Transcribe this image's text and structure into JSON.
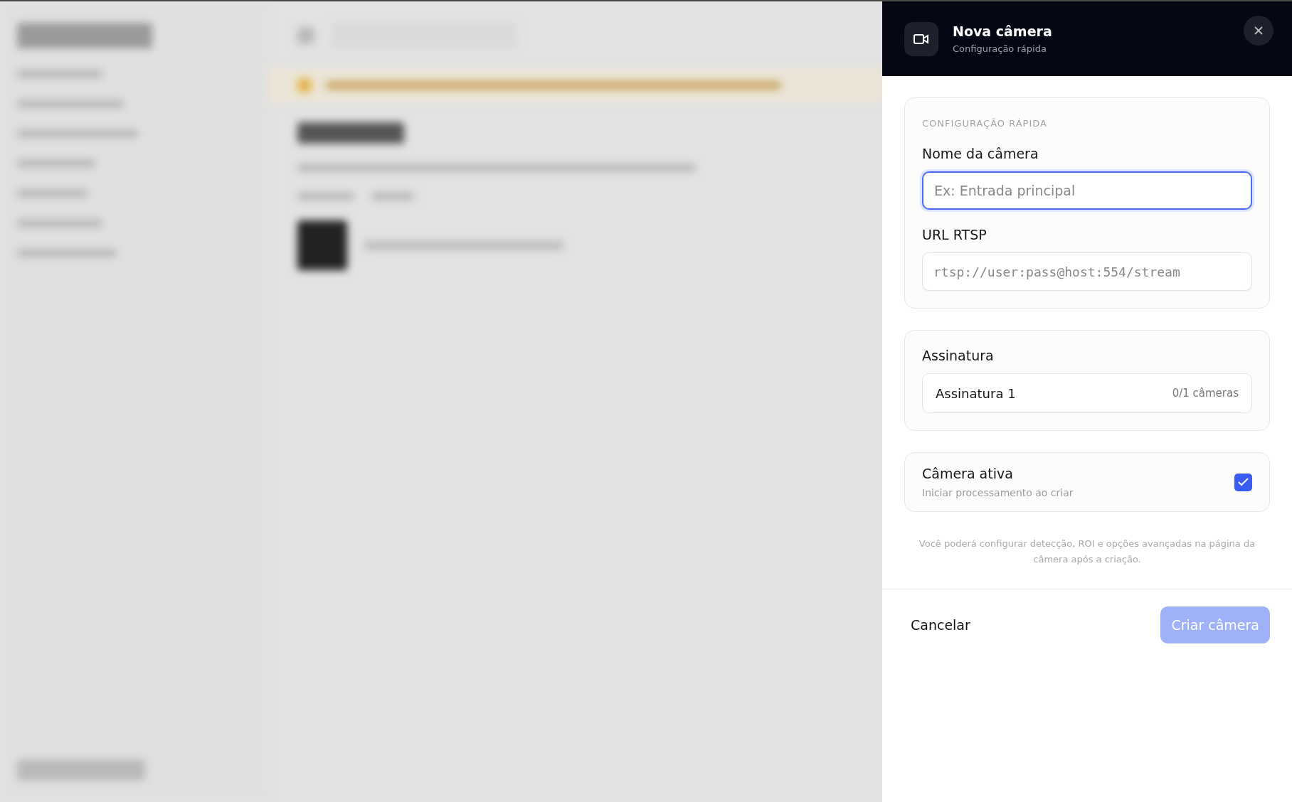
{
  "drawer": {
    "title": "Nova câmera",
    "subtitle": "Configuração rápida"
  },
  "quick_config": {
    "section_label": "CONFIGURAÇÃO RÁPIDA",
    "fields": [
      {
        "label": "Nome da câmera",
        "placeholder": "Ex: Entrada principal",
        "kind": "text",
        "focused": true
      },
      {
        "label": "URL RTSP",
        "placeholder": "rtsp://user:pass@host:554/stream",
        "kind": "mono",
        "focused": false
      }
    ]
  },
  "subscription": {
    "label": "Assinatura",
    "option": {
      "name": "Assinatura 1",
      "count": "0/1 câmeras"
    }
  },
  "active": {
    "label": "Câmera ativa",
    "hint": "Iniciar processamento ao criar",
    "checked": true
  },
  "note": "Você poderá configurar detecção, ROI e opções avançadas na página da câmera após a criação.",
  "footer": {
    "cancel": "Cancelar",
    "submit": "Criar câmera",
    "submit_disabled": true
  }
}
